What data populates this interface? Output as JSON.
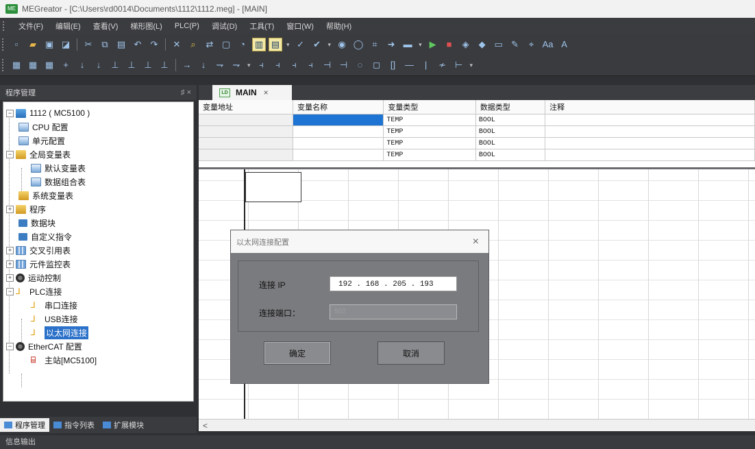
{
  "window": {
    "title": "MEGreator - [C:\\Users\\rd0014\\Documents\\1112\\1112.meg] - [MAIN]",
    "app_icon_text": "ME"
  },
  "menu": [
    "文件(F)",
    "编辑(E)",
    "查看(V)",
    "梯形图(L)",
    "PLC(P)",
    "调试(D)",
    "工具(T)",
    "窗口(W)",
    "帮助(H)"
  ],
  "left_panel": {
    "title": "程序管理",
    "header_controls": "♯ ×",
    "tree": {
      "root": "1112 ( MC5100 )",
      "cpu_config": "CPU 配置",
      "unit_config": "单元配置",
      "global_vars": "全局变量表",
      "default_vars": "默认变量表",
      "data_combo": "数据组合表",
      "system_vars": "系统变量表",
      "program": "程序",
      "data_block": "数据块",
      "custom_instr": "自定义指令",
      "cross_ref": "交叉引用表",
      "monitor": "元件监控表",
      "motion": "运动控制",
      "plc_conn": "PLC连接",
      "serial_conn": "串口连接",
      "usb_conn": "USB连接",
      "eth_conn": "以太网连接",
      "ethercat": "EtherCAT 配置",
      "master": "主站[MC5100]"
    },
    "bottom_tabs": [
      "程序管理",
      "指令列表",
      "扩展模块"
    ]
  },
  "status_bar": "信息输出",
  "doc_tab": {
    "label": "MAIN",
    "close": "×"
  },
  "var_table": {
    "headers": [
      "变量地址",
      "变量名称",
      "变量类型",
      "数据类型",
      "注释"
    ],
    "rows": [
      {
        "addr": "",
        "name": "",
        "vtype": "TEMP",
        "dtype": "BOOL",
        "comment": ""
      },
      {
        "addr": "",
        "name": "",
        "vtype": "TEMP",
        "dtype": "BOOL",
        "comment": ""
      },
      {
        "addr": "",
        "name": "",
        "vtype": "TEMP",
        "dtype": "BOOL",
        "comment": ""
      },
      {
        "addr": "",
        "name": "",
        "vtype": "TEMP",
        "dtype": "BOOL",
        "comment": ""
      }
    ]
  },
  "scroll_left": "<",
  "dialog": {
    "title": "以太网连接配置",
    "close": "×",
    "ip_label": "连接 IP",
    "ip_value": "192 . 168 . 205 . 193",
    "port_label": "连接端口：",
    "port_value": "502",
    "ok": "确定",
    "cancel": "取消"
  }
}
